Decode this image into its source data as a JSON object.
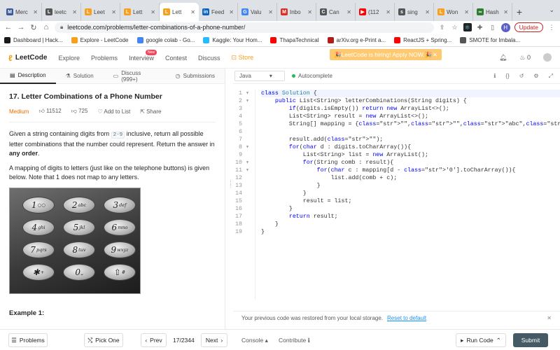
{
  "browser": {
    "tabs": [
      {
        "title": "Merc",
        "color": "#3b5998",
        "glyph": "M"
      },
      {
        "title": "leetc",
        "color": "#555555",
        "glyph": "L"
      },
      {
        "title": "Leet",
        "color": "#f89f1b",
        "glyph": "L"
      },
      {
        "title": "Lett",
        "color": "#f89f1b",
        "glyph": "L"
      },
      {
        "title": "Lett",
        "color": "#f89f1b",
        "glyph": "L",
        "active": true
      },
      {
        "title": "Feed",
        "color": "#0a66c2",
        "glyph": "in"
      },
      {
        "title": "Valu",
        "color": "#4285f4",
        "glyph": "G"
      },
      {
        "title": "Inbo",
        "color": "#d93025",
        "glyph": "M"
      },
      {
        "title": "Can",
        "color": "#555555",
        "glyph": "C"
      },
      {
        "title": "(112",
        "color": "#ff0000",
        "glyph": "▶"
      },
      {
        "title": "sing",
        "color": "#555555",
        "glyph": "s"
      },
      {
        "title": "Won",
        "color": "#f89f1b",
        "glyph": "L"
      },
      {
        "title": "Hash",
        "color": "#2e7d32",
        "glyph": "∞"
      }
    ],
    "url": "leetcode.com/problems/letter-combinations-of-a-phone-number/",
    "avatar_letter": "H",
    "update_label": "Update",
    "bookmarks": [
      {
        "label": "Dashboard | Hack...",
        "color": "#1a1a1a"
      },
      {
        "label": "Explore - LeetCode",
        "color": "#f89f1b"
      },
      {
        "label": "google colab - Go...",
        "color": "#4285f4"
      },
      {
        "label": "Kaggle: Your Hom...",
        "color": "#20beff"
      },
      {
        "label": "ThapaTechnical",
        "color": "#ff0000"
      },
      {
        "label": "arXiv.org e-Print a...",
        "color": "#b31b1b"
      },
      {
        "label": "ReactJS + Spring...",
        "color": "#ff0000"
      },
      {
        "label": "SMOTE for Imbala...",
        "color": "#555555"
      }
    ]
  },
  "lc_nav": {
    "logo": "LeetCode",
    "items": [
      "Explore",
      "Problems",
      "Interview",
      "Contest",
      "Discuss"
    ],
    "new_badge": "New",
    "store": "Store",
    "hiring": "🎉LeetCode is hiring! Apply NOW.🎉",
    "coins": "0"
  },
  "left_tabs": [
    "Description",
    "Solution",
    "Discuss (999+)",
    "Submissions"
  ],
  "problem": {
    "title": "17. Letter Combinations of a Phone Number",
    "difficulty": "Medium",
    "likes": "11512",
    "dislikes": "725",
    "add_to_list": "Add to List",
    "share": "Share",
    "desc1_a": "Given a string containing digits from ",
    "desc1_code": "2-9",
    "desc1_b": " inclusive, return all possible letter combinations that the number could represent. Return the answer in ",
    "desc1_bold": "any order",
    "desc1_c": ".",
    "desc2": "A mapping of digits to letters (just like on the telephone buttons) is given below. Note that 1 does not map to any letters.",
    "keypad": [
      {
        "d": "1",
        "l": "○○"
      },
      {
        "d": "2",
        "l": "abc"
      },
      {
        "d": "3",
        "l": "def"
      },
      {
        "d": "4",
        "l": "ghi"
      },
      {
        "d": "5",
        "l": "jkl"
      },
      {
        "d": "6",
        "l": "mno"
      },
      {
        "d": "7",
        "l": "pqrs"
      },
      {
        "d": "8",
        "l": "tuv"
      },
      {
        "d": "9",
        "l": "wxyz"
      },
      {
        "d": "✱",
        "l": "+"
      },
      {
        "d": "0",
        "l": "⎵"
      },
      {
        "d": "⇧",
        "l": "#"
      }
    ],
    "example_label": "Example 1:"
  },
  "editor": {
    "language": "Java",
    "autocomplete": "Autocomplete",
    "lines": [
      "class Solution {",
      "    public List<String> letterCombinations(String digits) {",
      "        if(digits.isEmpty()) return new ArrayList<>();",
      "        List<String> result = new ArrayList<>();",
      "        String[] mapping = {\"\",\"\",\"abc\",\"def\",\"ghi\",\"jkl\",\"mno\",\"pqrs\",\"tuv\",\"wxyz\"};",
      "",
      "        result.add(\"\");",
      "        for(char d : digits.toCharArray()){",
      "            List<String> list = new ArrayList();",
      "            for(String comb : result){",
      "                for(char c : mapping[d - '0'].toCharArray()){",
      "                    list.add(comb + c);",
      "                }",
      "            }",
      "            result = list;",
      "        }",
      "        return result;",
      "    }",
      "}"
    ],
    "fold_lines": [
      1,
      2,
      8,
      10,
      11
    ],
    "restore_msg": "Your previous code was restored from your local storage.",
    "restore_link": "Reset to default"
  },
  "bottom": {
    "problems": "Problems",
    "pick_one": "Pick One",
    "prev": "Prev",
    "page": "17/2344",
    "next": "Next",
    "console": "Console",
    "contribute": "Contribute",
    "run_code": "Run Code",
    "submit": "Submit"
  }
}
